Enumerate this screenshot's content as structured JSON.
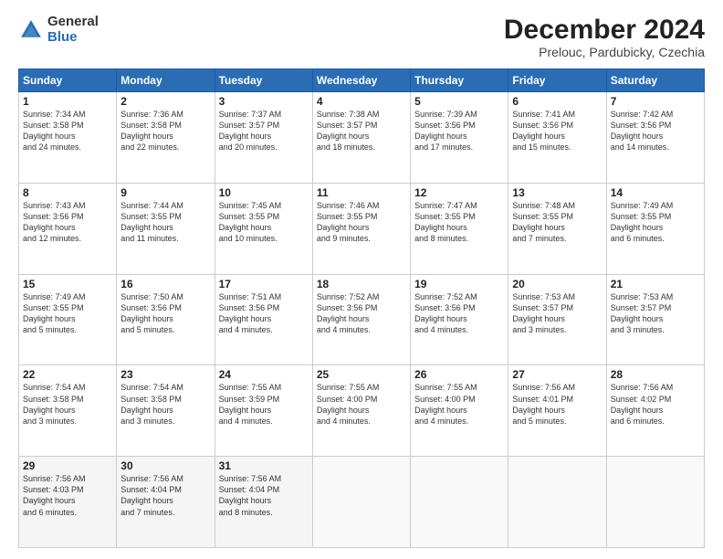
{
  "logo": {
    "general": "General",
    "blue": "Blue"
  },
  "title": "December 2024",
  "subtitle": "Prelouc, Pardubicky, Czechia",
  "weekdays": [
    "Sunday",
    "Monday",
    "Tuesday",
    "Wednesday",
    "Thursday",
    "Friday",
    "Saturday"
  ],
  "weeks": [
    [
      {
        "day": "1",
        "sunrise": "7:34 AM",
        "sunset": "3:58 PM",
        "daylight": "8 hours and 24 minutes."
      },
      {
        "day": "2",
        "sunrise": "7:36 AM",
        "sunset": "3:58 PM",
        "daylight": "8 hours and 22 minutes."
      },
      {
        "day": "3",
        "sunrise": "7:37 AM",
        "sunset": "3:57 PM",
        "daylight": "8 hours and 20 minutes."
      },
      {
        "day": "4",
        "sunrise": "7:38 AM",
        "sunset": "3:57 PM",
        "daylight": "8 hours and 18 minutes."
      },
      {
        "day": "5",
        "sunrise": "7:39 AM",
        "sunset": "3:56 PM",
        "daylight": "8 hours and 17 minutes."
      },
      {
        "day": "6",
        "sunrise": "7:41 AM",
        "sunset": "3:56 PM",
        "daylight": "8 hours and 15 minutes."
      },
      {
        "day": "7",
        "sunrise": "7:42 AM",
        "sunset": "3:56 PM",
        "daylight": "8 hours and 14 minutes."
      }
    ],
    [
      {
        "day": "8",
        "sunrise": "7:43 AM",
        "sunset": "3:56 PM",
        "daylight": "8 hours and 12 minutes."
      },
      {
        "day": "9",
        "sunrise": "7:44 AM",
        "sunset": "3:55 PM",
        "daylight": "8 hours and 11 minutes."
      },
      {
        "day": "10",
        "sunrise": "7:45 AM",
        "sunset": "3:55 PM",
        "daylight": "8 hours and 10 minutes."
      },
      {
        "day": "11",
        "sunrise": "7:46 AM",
        "sunset": "3:55 PM",
        "daylight": "8 hours and 9 minutes."
      },
      {
        "day": "12",
        "sunrise": "7:47 AM",
        "sunset": "3:55 PM",
        "daylight": "8 hours and 8 minutes."
      },
      {
        "day": "13",
        "sunrise": "7:48 AM",
        "sunset": "3:55 PM",
        "daylight": "8 hours and 7 minutes."
      },
      {
        "day": "14",
        "sunrise": "7:49 AM",
        "sunset": "3:55 PM",
        "daylight": "8 hours and 6 minutes."
      }
    ],
    [
      {
        "day": "15",
        "sunrise": "7:49 AM",
        "sunset": "3:55 PM",
        "daylight": "8 hours and 5 minutes."
      },
      {
        "day": "16",
        "sunrise": "7:50 AM",
        "sunset": "3:56 PM",
        "daylight": "8 hours and 5 minutes."
      },
      {
        "day": "17",
        "sunrise": "7:51 AM",
        "sunset": "3:56 PM",
        "daylight": "8 hours and 4 minutes."
      },
      {
        "day": "18",
        "sunrise": "7:52 AM",
        "sunset": "3:56 PM",
        "daylight": "8 hours and 4 minutes."
      },
      {
        "day": "19",
        "sunrise": "7:52 AM",
        "sunset": "3:56 PM",
        "daylight": "8 hours and 4 minutes."
      },
      {
        "day": "20",
        "sunrise": "7:53 AM",
        "sunset": "3:57 PM",
        "daylight": "8 hours and 3 minutes."
      },
      {
        "day": "21",
        "sunrise": "7:53 AM",
        "sunset": "3:57 PM",
        "daylight": "8 hours and 3 minutes."
      }
    ],
    [
      {
        "day": "22",
        "sunrise": "7:54 AM",
        "sunset": "3:58 PM",
        "daylight": "8 hours and 3 minutes."
      },
      {
        "day": "23",
        "sunrise": "7:54 AM",
        "sunset": "3:58 PM",
        "daylight": "8 hours and 3 minutes."
      },
      {
        "day": "24",
        "sunrise": "7:55 AM",
        "sunset": "3:59 PM",
        "daylight": "8 hours and 4 minutes."
      },
      {
        "day": "25",
        "sunrise": "7:55 AM",
        "sunset": "4:00 PM",
        "daylight": "8 hours and 4 minutes."
      },
      {
        "day": "26",
        "sunrise": "7:55 AM",
        "sunset": "4:00 PM",
        "daylight": "8 hours and 4 minutes."
      },
      {
        "day": "27",
        "sunrise": "7:56 AM",
        "sunset": "4:01 PM",
        "daylight": "8 hours and 5 minutes."
      },
      {
        "day": "28",
        "sunrise": "7:56 AM",
        "sunset": "4:02 PM",
        "daylight": "8 hours and 6 minutes."
      }
    ],
    [
      {
        "day": "29",
        "sunrise": "7:56 AM",
        "sunset": "4:03 PM",
        "daylight": "8 hours and 6 minutes."
      },
      {
        "day": "30",
        "sunrise": "7:56 AM",
        "sunset": "4:04 PM",
        "daylight": "8 hours and 7 minutes."
      },
      {
        "day": "31",
        "sunrise": "7:56 AM",
        "sunset": "4:04 PM",
        "daylight": "8 hours and 8 minutes."
      },
      null,
      null,
      null,
      null
    ]
  ],
  "labels": {
    "sunrise": "Sunrise:",
    "sunset": "Sunset:",
    "daylight": "Daylight:"
  }
}
